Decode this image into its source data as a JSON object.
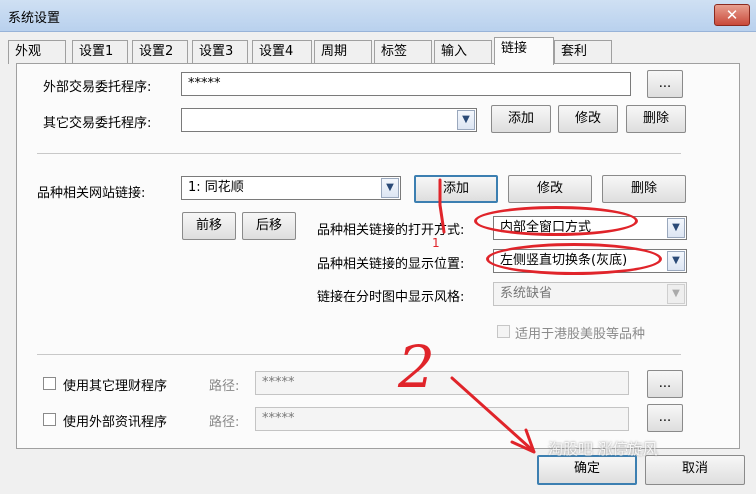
{
  "window": {
    "title": "系统设置",
    "close_glyph": "✕"
  },
  "tabs": [
    {
      "label": "外观"
    },
    {
      "label": "设置1"
    },
    {
      "label": "设置2"
    },
    {
      "label": "设置3"
    },
    {
      "label": "设置4"
    },
    {
      "label": "周期"
    },
    {
      "label": "标签"
    },
    {
      "label": "输入"
    },
    {
      "label": "链接",
      "active": true
    },
    {
      "label": "套利"
    }
  ],
  "trade": {
    "external_label": "外部交易委托程序:",
    "external_value": "*****",
    "browse_label": "...",
    "other_label": "其它交易委托程序:",
    "other_value": "",
    "add": "添加",
    "edit": "修改",
    "delete": "删除"
  },
  "links": {
    "site_label": "品种相关网站链接:",
    "site_value": "1: 同花顺",
    "add": "添加",
    "edit": "修改",
    "delete": "删除",
    "move_up": "前移",
    "move_down": "后移",
    "open_mode_label": "品种相关链接的打开方式:",
    "open_mode_value": "内部全窗口方式",
    "position_label": "品种相关链接的显示位置:",
    "position_value": "左侧竖直切换条(灰底)",
    "style_label": "链接在分时图中显示风格:",
    "style_value": "系统缺省",
    "hk_us_label": "适用于港股美股等品种"
  },
  "programs": {
    "finance_label": "使用其它理财程序",
    "finance_path_label": "路径:",
    "finance_path_value": "*****",
    "news_label": "使用外部资讯程序",
    "news_path_label": "路径:",
    "news_path_value": "*****",
    "browse_label": "..."
  },
  "footer": {
    "ok": "确定",
    "cancel": "取消"
  },
  "annotations": {
    "mark_1": "1",
    "mark_2": "2",
    "color": "#e0242a"
  },
  "watermark": {
    "text": "淘股吧 涨停旋风"
  },
  "icons": {
    "dropdown": "chevron-down-icon",
    "close": "close-icon",
    "annotation": "arrow-icon"
  }
}
